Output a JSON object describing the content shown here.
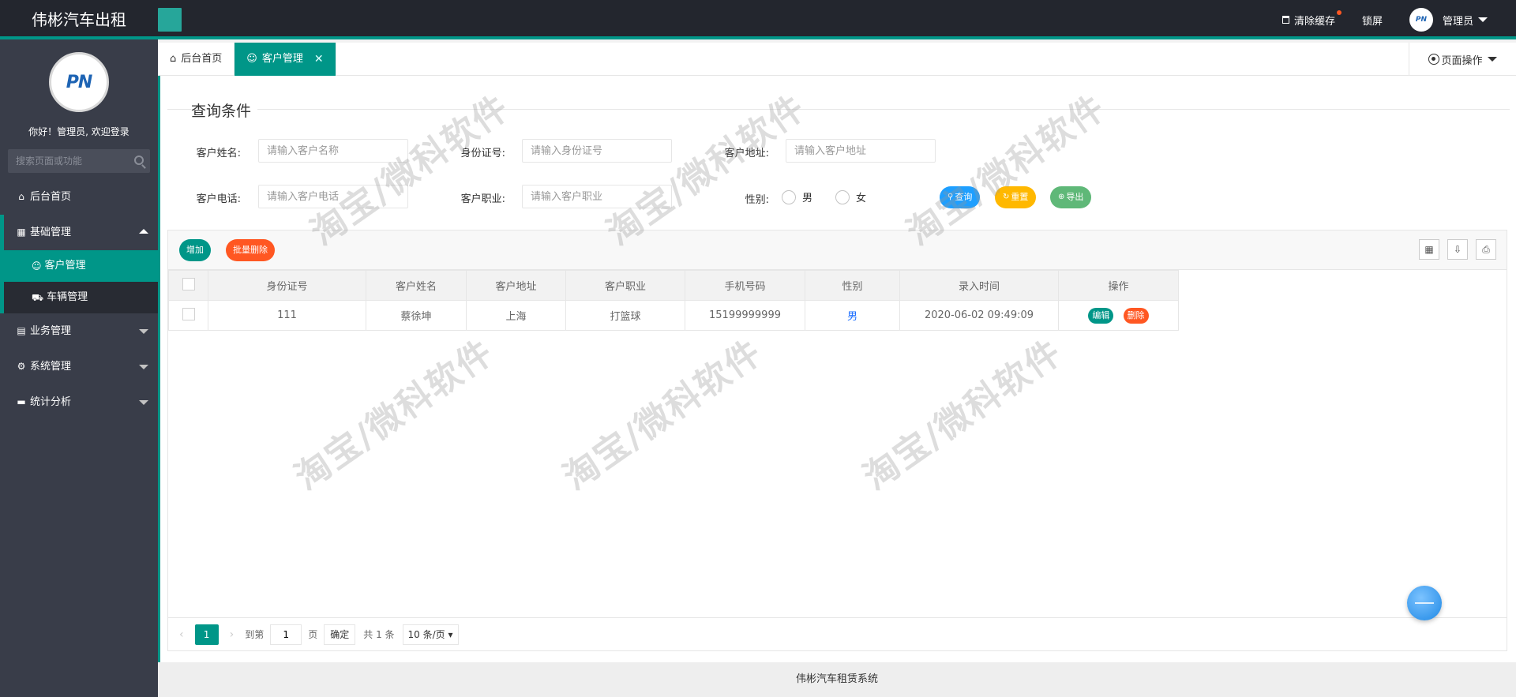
{
  "header": {
    "brand": "伟彬汽车出租",
    "clear_cache": "清除缓存",
    "lock_screen": "锁屏",
    "user": "管理员"
  },
  "sidebar": {
    "logo_text": "PN",
    "welcome": "你好！管理员, 欢迎登录",
    "search_placeholder": "搜索页面或功能",
    "items": {
      "home": "后台首页",
      "basic": "基础管理",
      "customer": "客户管理",
      "vehicle": "车辆管理",
      "business": "业务管理",
      "system": "系统管理",
      "stats": "统计分析"
    }
  },
  "tabs": {
    "home": "后台首页",
    "customer": "客户管理",
    "page_ops": "页面操作"
  },
  "query": {
    "legend": "查询条件",
    "name_label": "客户姓名:",
    "name_placeholder": "请输入客户名称",
    "id_label": "身份证号:",
    "id_placeholder": "请输入身份证号",
    "address_label": "客户地址:",
    "address_placeholder": "请输入客户地址",
    "phone_label": "客户电话:",
    "phone_placeholder": "请输入客户电话",
    "job_label": "客户职业:",
    "job_placeholder": "请输入客户职业",
    "gender_label": "性别:",
    "gender_male": "男",
    "gender_female": "女",
    "search_btn": "查询",
    "reset_btn": "重置",
    "export_btn": "导出"
  },
  "toolbar": {
    "add": "增加",
    "batch_delete": "批量删除"
  },
  "table": {
    "headers": [
      "身份证号",
      "客户姓名",
      "客户地址",
      "客户职业",
      "手机号码",
      "性别",
      "录入时间",
      "操作"
    ],
    "rows": [
      {
        "id": "111",
        "name": "蔡徐坤",
        "address": "上海",
        "job": "打篮球",
        "phone": "15199999999",
        "gender": "男",
        "time": "2020-06-02 09:49:09",
        "edit": "编辑",
        "delete": "删除"
      }
    ]
  },
  "pager": {
    "current": "1",
    "goto": "到第",
    "page_input": "1",
    "page_unit": "页",
    "confirm": "确定",
    "total": "共 1 条",
    "per_page": "10 条/页"
  },
  "watermark": "淘宝/微科软件",
  "footer": "伟彬汽车租赁系统",
  "colors": {
    "accent": "#009688",
    "header_bg": "#23262e",
    "sidebar_bg": "#393d49",
    "danger": "#ff5722",
    "search_blue": "#1e9fff",
    "warn": "#ffb800",
    "export_green": "#5fb878"
  }
}
